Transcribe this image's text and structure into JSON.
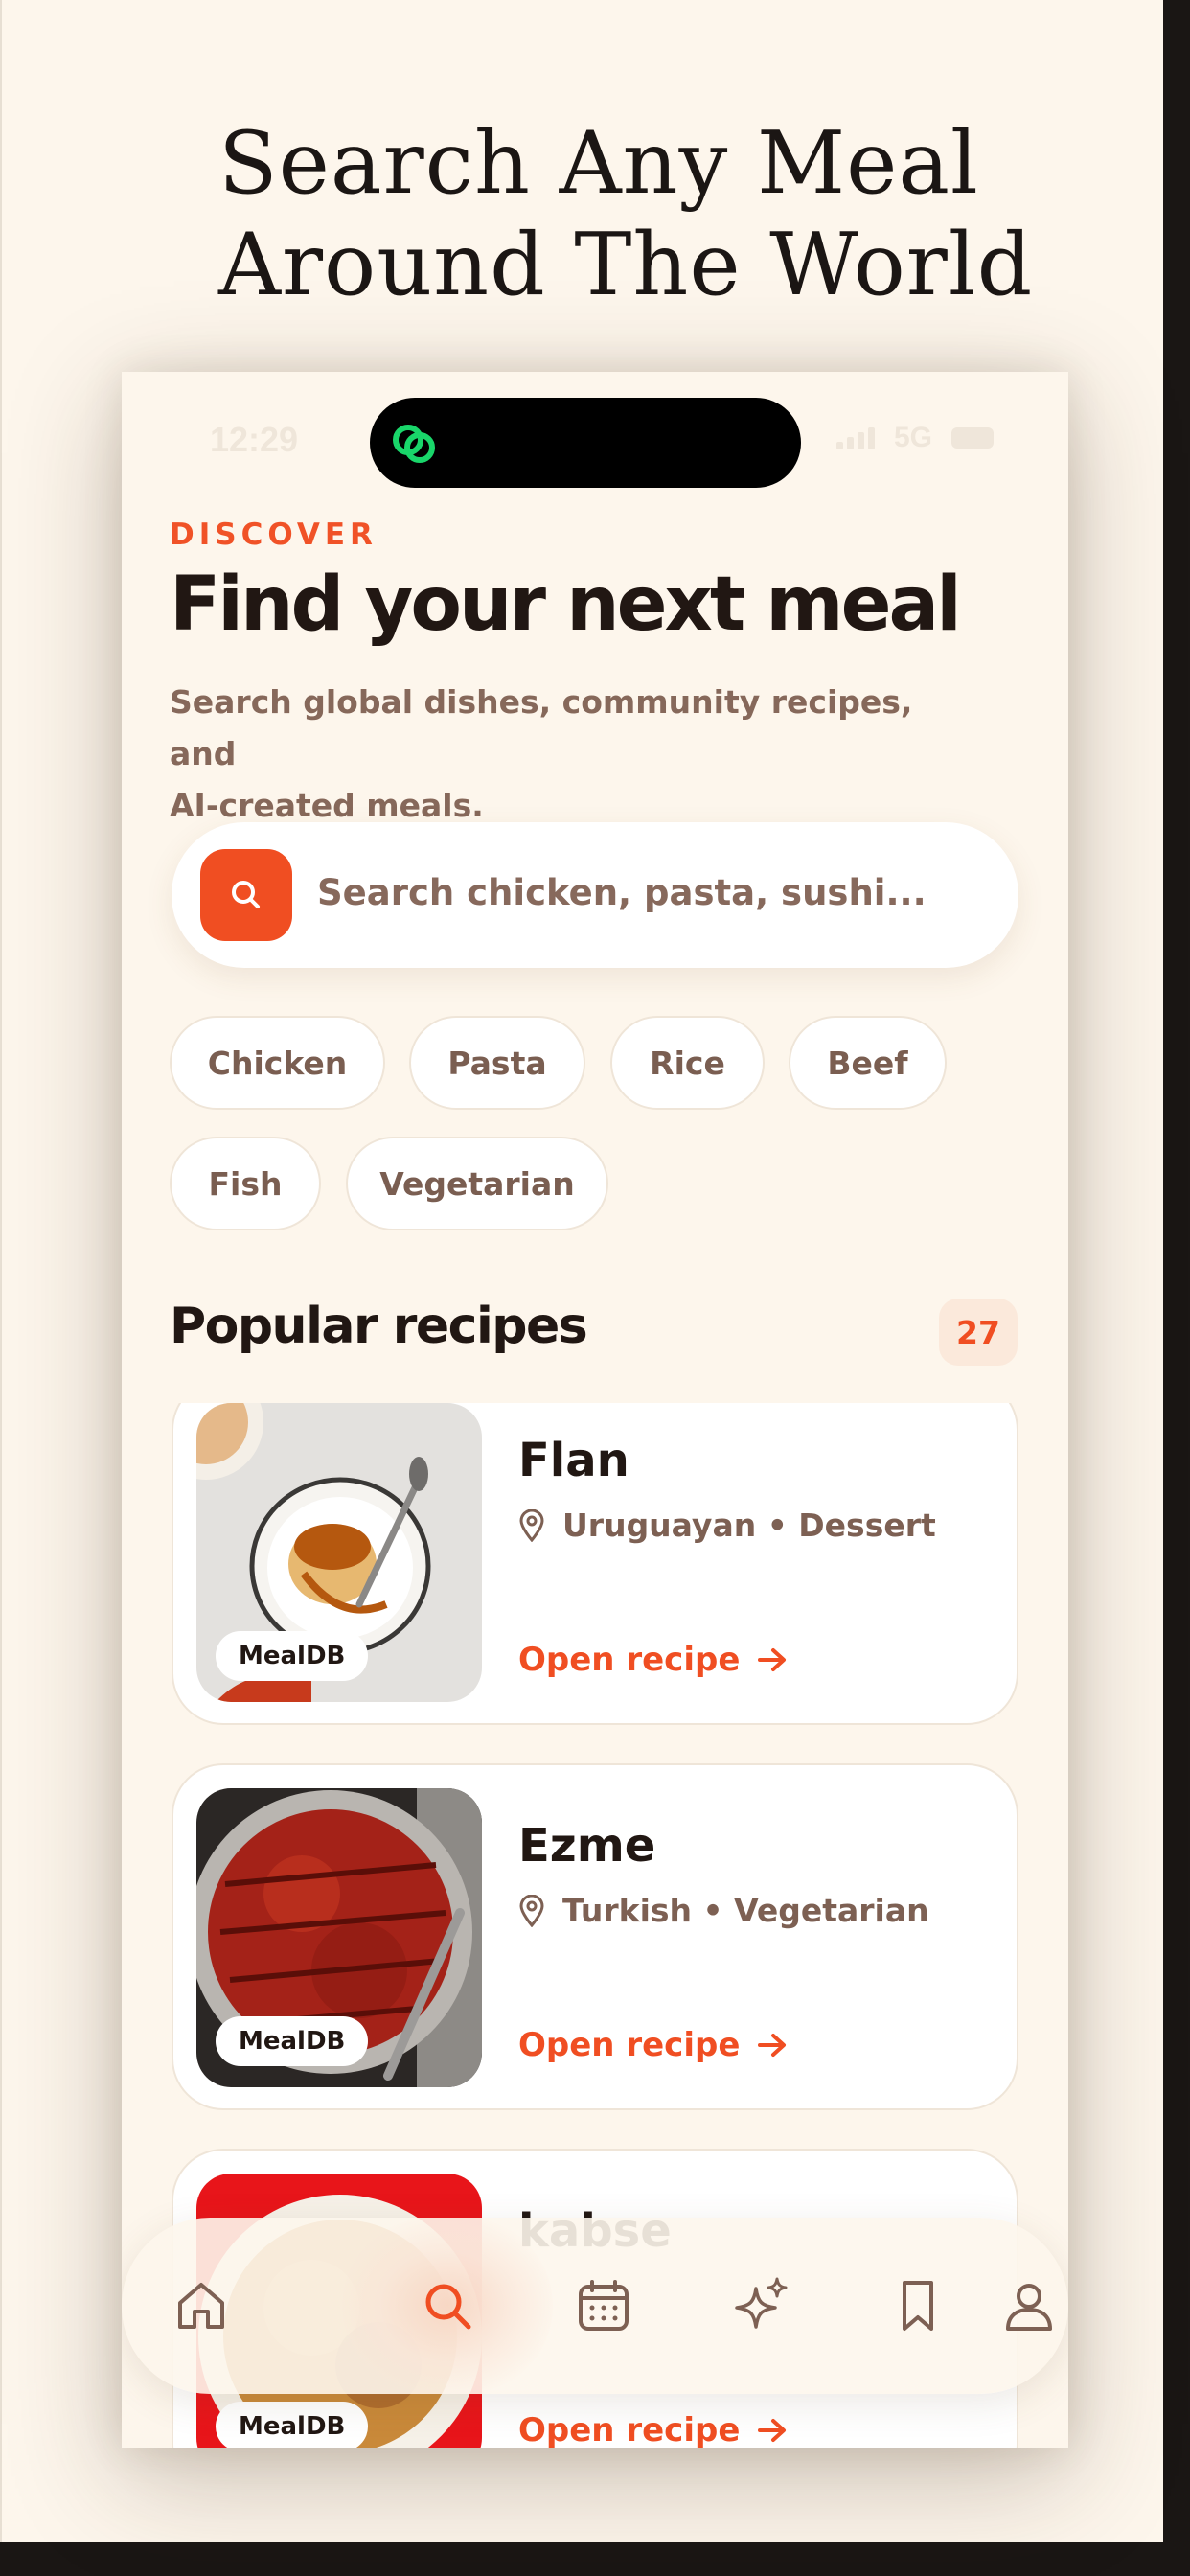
{
  "headline": {
    "line1": "Search Any Meal",
    "line2": "Around The World"
  },
  "status_bar": {
    "time": "12:29",
    "network": "5G"
  },
  "colors": {
    "accent": "#f04e22",
    "background": "#fdf6ec",
    "text_dark": "#211713",
    "text_muted": "#86685a",
    "island_logo": "#19d66a"
  },
  "discover": {
    "eyebrow": "DISCOVER",
    "title": "Find your next meal",
    "subtitle_line1": "Search global dishes, community recipes, and",
    "subtitle_line2": "AI-created meals."
  },
  "search": {
    "placeholder": "Search chicken, pasta, sushi...",
    "icon": "search-icon"
  },
  "chips": [
    "Chicken",
    "Pasta",
    "Rice",
    "Beef",
    "Fish",
    "Vegetarian"
  ],
  "popular": {
    "title": "Popular recipes",
    "count": "27",
    "cards": [
      {
        "title": "Flan",
        "meta": "Uruguayan • Dessert",
        "badge": "MealDB",
        "link": "Open recipe"
      },
      {
        "title": "Ezme",
        "meta": "Turkish • Vegetarian",
        "badge": "MealDB",
        "link": "Open recipe"
      },
      {
        "title": "kabse",
        "meta": "",
        "badge": "MealDB",
        "link": "Open recipe"
      }
    ]
  },
  "tabbar": {
    "active": "search",
    "items": [
      {
        "icon": "home-icon"
      },
      {
        "icon": "search-icon"
      },
      {
        "icon": "calendar-icon"
      },
      {
        "icon": "sparkles-icon"
      },
      {
        "icon": "bookmark-icon"
      },
      {
        "icon": "profile-icon"
      }
    ]
  }
}
